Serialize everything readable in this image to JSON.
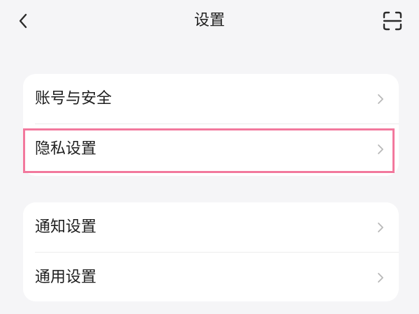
{
  "header": {
    "title": "设置",
    "back_icon": "chevron-left-icon",
    "scan_icon": "scan-icon"
  },
  "groups": [
    {
      "items": [
        {
          "label": "账号与安全",
          "icon": "chevron-right-icon"
        },
        {
          "label": "隐私设置",
          "icon": "chevron-right-icon",
          "highlighted": true
        }
      ]
    },
    {
      "items": [
        {
          "label": "通知设置",
          "icon": "chevron-right-icon"
        },
        {
          "label": "通用设置",
          "icon": "chevron-right-icon"
        }
      ]
    }
  ],
  "colors": {
    "background": "#f5f5f7",
    "card": "#ffffff",
    "text": "#1f1f1f",
    "chevron": "#b8b8b8",
    "highlight": "#f2789d"
  }
}
